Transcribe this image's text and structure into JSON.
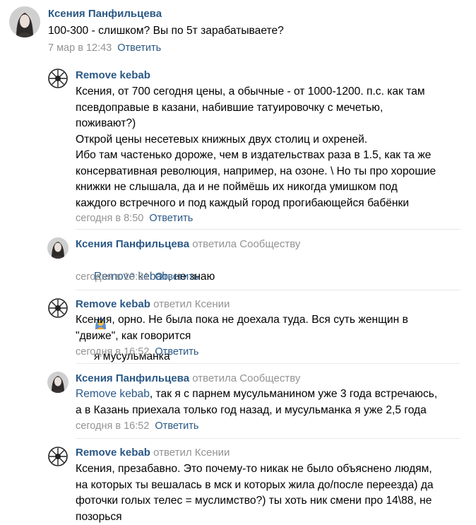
{
  "comments": [
    {
      "author": "Ксения Панфильцева",
      "text": "100-300 - слишком? Вы по 5т зарабатываете?",
      "date": "7 мар в 12:43",
      "reply_label": "Ответить"
    },
    {
      "author": "Remove kebab",
      "reply_to": "",
      "text": "Ксения, от 700 сегодня цены, а обычные - от 1000-1200. п.с. как там\nпсевдоправые в казани, набившие татуировочку с мечетью,\nпоживают?)\nОткрой цены несетевых книжных двух столиц и охреней.\nИбо там частенько дороже, чем в издательствах раза в 1.5, как та же\nконсервативная революция, например, на озоне. \\ Но ты про хорошие\nкнижки не слышала, да и не поймёшь их никогда умишком под\nкаждого встречного и под каждый город прогибающейся бабёнки",
      "date": "сегодня в 8:50",
      "reply_label": "Ответить"
    },
    {
      "author": "Ксения Панфильцева",
      "reply_to": "ответила Сообществу",
      "mention": "Remove kebab",
      "text_before_emoji": ", не знаю",
      "text_after_emoji": "я мусульманка",
      "emoji_name": "woman-in-headscarf-icon",
      "date": "сегодня в 10:01",
      "reply_label": "Ответить"
    },
    {
      "author": "Remove kebab",
      "reply_to": "ответил Ксении",
      "text": "Ксения, орно. Не была пока не доехала туда. Вся суть женщин в\n\"движе\", как говорится",
      "date": "сегодня в 16:52",
      "reply_label": "Ответить"
    },
    {
      "author": "Ксения Панфильцева",
      "reply_to": "ответила Сообществу",
      "mention": "Remove kebab",
      "text": ", так я с парнем мусульманином уже 3 года встречаюсь,\nа в Казань приехала только год назад, и мусульманка я уже 2,5 года",
      "date": "сегодня в 16:52",
      "reply_label": "Ответить"
    },
    {
      "author": "Remove kebab",
      "reply_to": "ответил Ксении",
      "text": "Ксения, презабавно. Это почему-то никак не было объяснено людям,\nна которых ты вешалась в мск и которых жила до/после переезда) да\nфоточки голых телес = муслимство?) ты хоть ник смени про 14\\88, не\nпозорься"
    }
  ],
  "colors": {
    "link": "#2a5885",
    "meta": "#939393",
    "divider": "#e7e8ec"
  }
}
